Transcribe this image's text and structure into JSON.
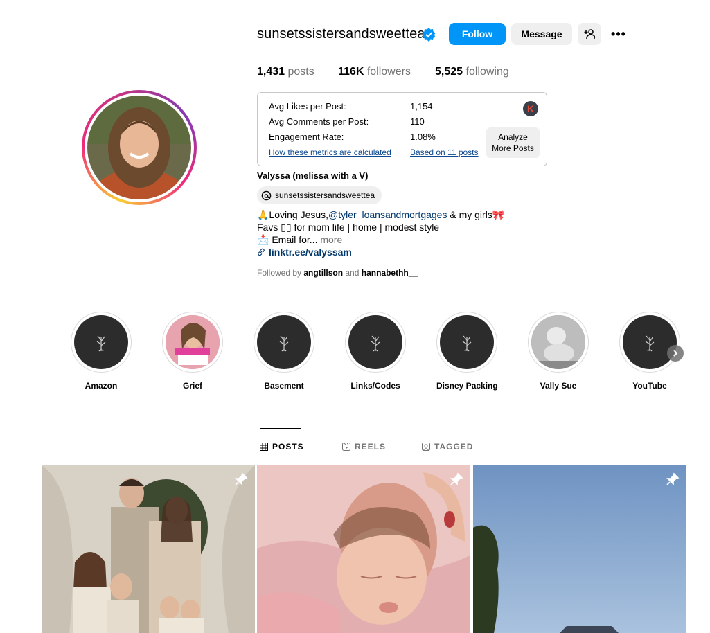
{
  "profile": {
    "username": "sunsetssistersandsweettea",
    "full_name": "Valyssa (melissa with a V)",
    "threads_handle": "sunsetssistersandsweettea",
    "verified": true
  },
  "actions": {
    "follow": "Follow",
    "message": "Message",
    "add_user_icon": "add-person-icon",
    "more_icon": "more-options-icon",
    "more_label": "•••"
  },
  "stats": {
    "posts_count": "1,431",
    "posts_label": " posts",
    "followers_count": "116K",
    "followers_label": " followers",
    "following_count": "5,525",
    "following_label": " following"
  },
  "metrics": {
    "avg_likes_label": "Avg Likes per Post:",
    "avg_likes_value": "1,154",
    "avg_comments_label": "Avg Comments per Post:",
    "avg_comments_value": "110",
    "engagement_label": "Engagement Rate:",
    "engagement_value": "1.08%",
    "how_link": "How these metrics are calculated",
    "based_link": "Based on 11 posts",
    "analyze_line1": "Analyze",
    "analyze_line2": "More Posts",
    "badge": "K"
  },
  "bio": {
    "line1_prefix": "🙏Loving Jesus,",
    "line1_mention": "@tyler_loansandmortgages",
    "line1_suffix": " & my girls🎀",
    "line2": "Favs ▯▯ for mom life | home | modest style",
    "line3": "📩 Email for...",
    "more": " more",
    "link": "linktr.ee/valyssam"
  },
  "followed_by": {
    "prefix": "Followed by ",
    "user1": "angtillson",
    "and": " and ",
    "user2": "hannabethh__"
  },
  "highlights": [
    {
      "label": "Amazon"
    },
    {
      "label": "Grief"
    },
    {
      "label": "Basement"
    },
    {
      "label": "Links/Codes"
    },
    {
      "label": "Disney Packing"
    },
    {
      "label": "Vally Sue"
    },
    {
      "label": "YouTube"
    }
  ],
  "tabs": [
    {
      "label": "POSTS",
      "active": true
    },
    {
      "label": "REELS",
      "active": false
    },
    {
      "label": "TAGGED",
      "active": false
    }
  ],
  "colors": {
    "follow_blue": "#0095f6",
    "link_blue": "#00376b",
    "muted": "#737373"
  }
}
